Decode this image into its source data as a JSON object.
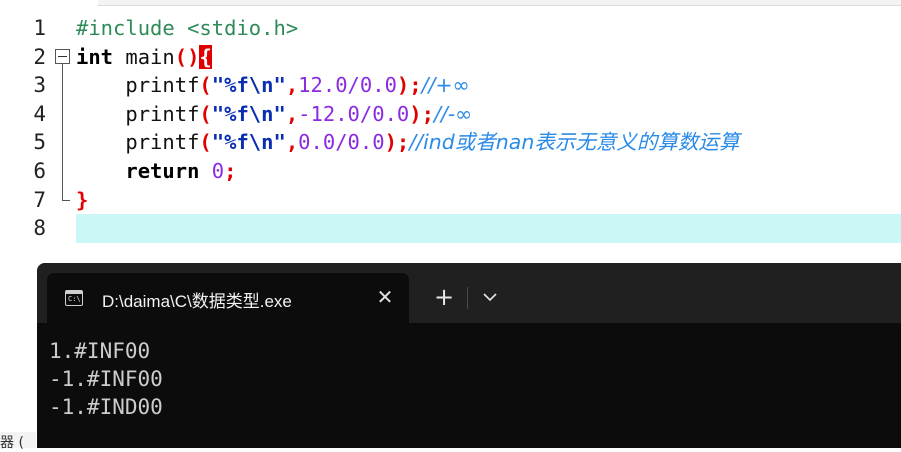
{
  "editor": {
    "line_numbers": [
      "1",
      "2",
      "3",
      "4",
      "5",
      "6",
      "7",
      "8"
    ],
    "lines": {
      "l1_pre": "#include <stdio.h>",
      "l2_kw": "int",
      "l2_fn": " main",
      "l2_parens": "()",
      "l2_brace": "{",
      "printf": "    printf",
      "open": "(",
      "fmt": "\"%f\\n\"",
      "comma": ",",
      "l3_num": "12.0/0.0",
      "l3_comment": "//+∞",
      "l4_num": "-12.0/0.0",
      "l4_comment": "//-∞",
      "l5_num": "0.0/0.0",
      "l5_comment": "//ind或者nan表示无意义的算数运算",
      "close": ")",
      "semi": ";",
      "l6_kw": "    return",
      "l6_num": " 0",
      "l7_brace": "}"
    }
  },
  "side_fragment": "器 (",
  "terminal": {
    "tab_title": "D:\\daima\\C\\数据类型.exe",
    "tab_icon_text": "C:\\",
    "close_glyph": "✕",
    "new_tab_glyph": "+",
    "output": [
      "1.#INF00",
      "-1.#INF00",
      "-1.#IND00"
    ]
  }
}
